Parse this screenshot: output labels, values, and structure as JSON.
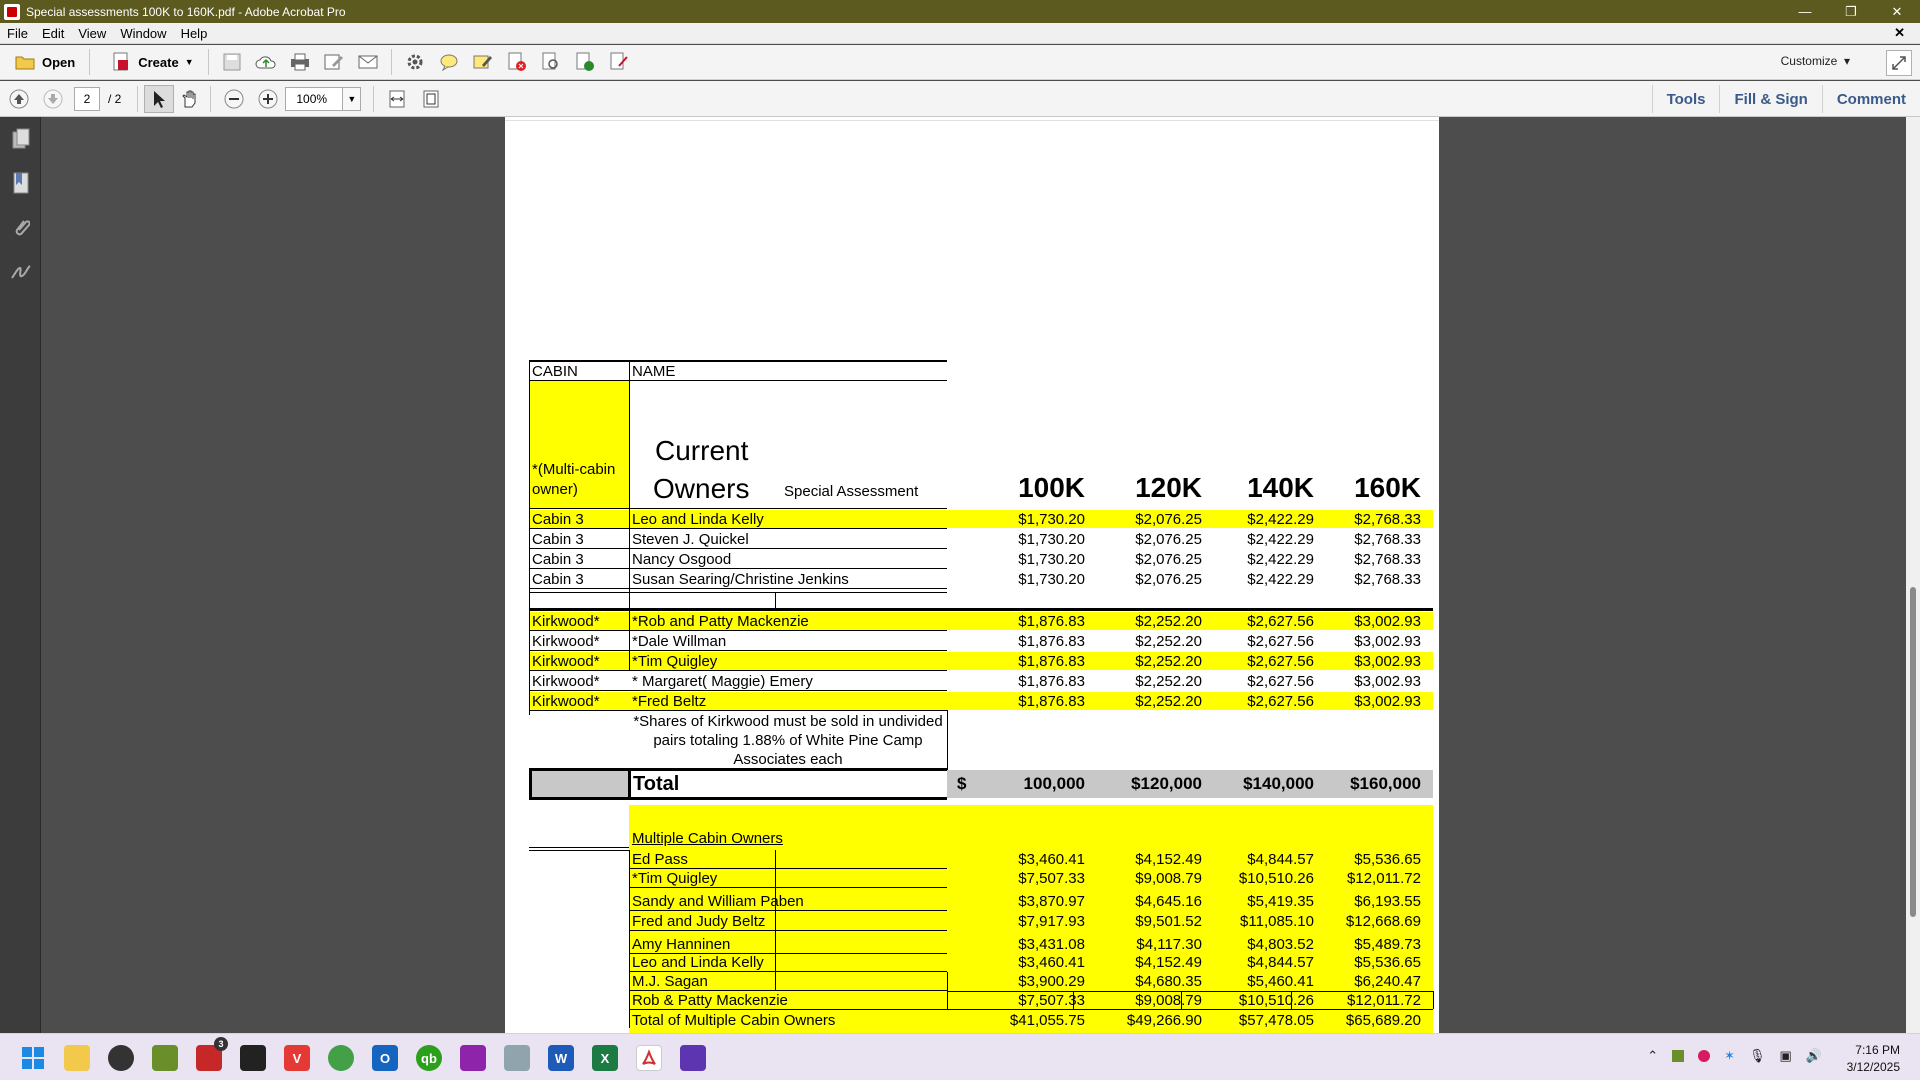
{
  "window": {
    "title": "Special assessments 100K to 160K.pdf - Adobe Acrobat Pro"
  },
  "menu": [
    "File",
    "Edit",
    "View",
    "Window",
    "Help"
  ],
  "toolbar": {
    "open": "Open",
    "create": "Create",
    "customize": "Customize"
  },
  "nav": {
    "page_current": "2",
    "page_total": "/ 2",
    "zoom": "100%"
  },
  "panel_links": [
    "Tools",
    "Fill & Sign",
    "Comment"
  ],
  "sheet": {
    "header_cabin": "CABIN",
    "header_name": "NAME",
    "multi_note_line1": "*(Multi-cabin",
    "multi_note_line2": "owner)",
    "current": "Current",
    "owners": "Owners",
    "special": "Special Assessment",
    "cols": [
      "100K",
      "120K",
      "140K",
      "160K"
    ],
    "rows": [
      {
        "cabin": "Cabin 3",
        "name": "Leo and Linda Kelly",
        "vals": [
          "$1,730.20",
          "$2,076.25",
          "$2,422.29",
          "$2,768.33"
        ],
        "hl": true
      },
      {
        "cabin": "Cabin 3",
        "name": "Steven J. Quickel",
        "vals": [
          "$1,730.20",
          "$2,076.25",
          "$2,422.29",
          "$2,768.33"
        ],
        "hl": false
      },
      {
        "cabin": "Cabin 3",
        "name": "Nancy Osgood",
        "vals": [
          "$1,730.20",
          "$2,076.25",
          "$2,422.29",
          "$2,768.33"
        ],
        "hl": false
      },
      {
        "cabin": "Cabin 3",
        "name": "Susan Searing/Christine Jenkins",
        "vals": [
          "$1,730.20",
          "$2,076.25",
          "$2,422.29",
          "$2,768.33"
        ],
        "hl": false
      },
      {
        "cabin": "Kirkwood*",
        "name": "*Rob and Patty Mackenzie",
        "vals": [
          "$1,876.83",
          "$2,252.20",
          "$2,627.56",
          "$3,002.93"
        ],
        "hl": true
      },
      {
        "cabin": "Kirkwood*",
        "name": "*Dale Willman",
        "vals": [
          "$1,876.83",
          "$2,252.20",
          "$2,627.56",
          "$3,002.93"
        ],
        "hl": false
      },
      {
        "cabin": "Kirkwood*",
        "name": "*Tim Quigley",
        "vals": [
          "$1,876.83",
          "$2,252.20",
          "$2,627.56",
          "$3,002.93"
        ],
        "hl": true
      },
      {
        "cabin": "Kirkwood*",
        "name": "* Margaret( Maggie)  Emery",
        "vals": [
          "$1,876.83",
          "$2,252.20",
          "$2,627.56",
          "$3,002.93"
        ],
        "hl": false
      },
      {
        "cabin": "Kirkwood*",
        "name": "*Fred Beltz",
        "vals": [
          "$1,876.83",
          "$2,252.20",
          "$2,627.56",
          "$3,002.93"
        ],
        "hl": true
      }
    ],
    "kirkwood_note": [
      "*Shares of Kirkwood must be sold in undivided",
      "pairs totaling 1.88% of White Pine Camp",
      "Associates each"
    ],
    "total_label": "Total",
    "total_dollar": "$",
    "totals": [
      "100,000",
      "$120,000",
      "$140,000",
      "$160,000"
    ],
    "multi_title": "Multiple Cabin Owners",
    "multi_rows": [
      {
        "name": "Ed Pass",
        "vals": [
          "$3,460.41",
          "$4,152.49",
          "$4,844.57",
          "$5,536.65"
        ]
      },
      {
        "name": "*Tim Quigley",
        "vals": [
          "$7,507.33",
          "$9,008.79",
          "$10,510.26",
          "$12,011.72"
        ]
      },
      {
        "name": "Sandy and William Paben",
        "vals": [
          "$3,870.97",
          "$4,645.16",
          "$5,419.35",
          "$6,193.55"
        ]
      },
      {
        "name": "Fred and Judy Beltz",
        "vals": [
          "$7,917.93",
          "$9,501.52",
          "$11,085.10",
          "$12,668.69"
        ]
      },
      {
        "name": "Amy Hanninen",
        "vals": [
          "$3,431.08",
          "$4,117.30",
          "$4,803.52",
          "$5,489.73"
        ]
      },
      {
        "name": "Leo and Linda Kelly",
        "vals": [
          "$3,460.41",
          "$4,152.49",
          "$4,844.57",
          "$5,536.65"
        ]
      },
      {
        "name": "M.J. Sagan",
        "vals": [
          "$3,900.29",
          "$4,680.35",
          "$5,460.41",
          "$6,240.47"
        ]
      },
      {
        "name": "Rob & Patty Mackenzie",
        "vals": [
          "$7,507.33",
          "$9,008.79",
          "$10,510.26",
          "$12,011.72"
        ]
      },
      {
        "name": "Total of Multiple Cabin Owners",
        "vals": [
          "$41,055.75",
          "$49,266.90",
          "$57,478.05",
          "$65,689.20"
        ]
      }
    ]
  },
  "clock": {
    "time": "7:16 PM",
    "date": "3/12/2025"
  },
  "taskbar_badge": "3"
}
